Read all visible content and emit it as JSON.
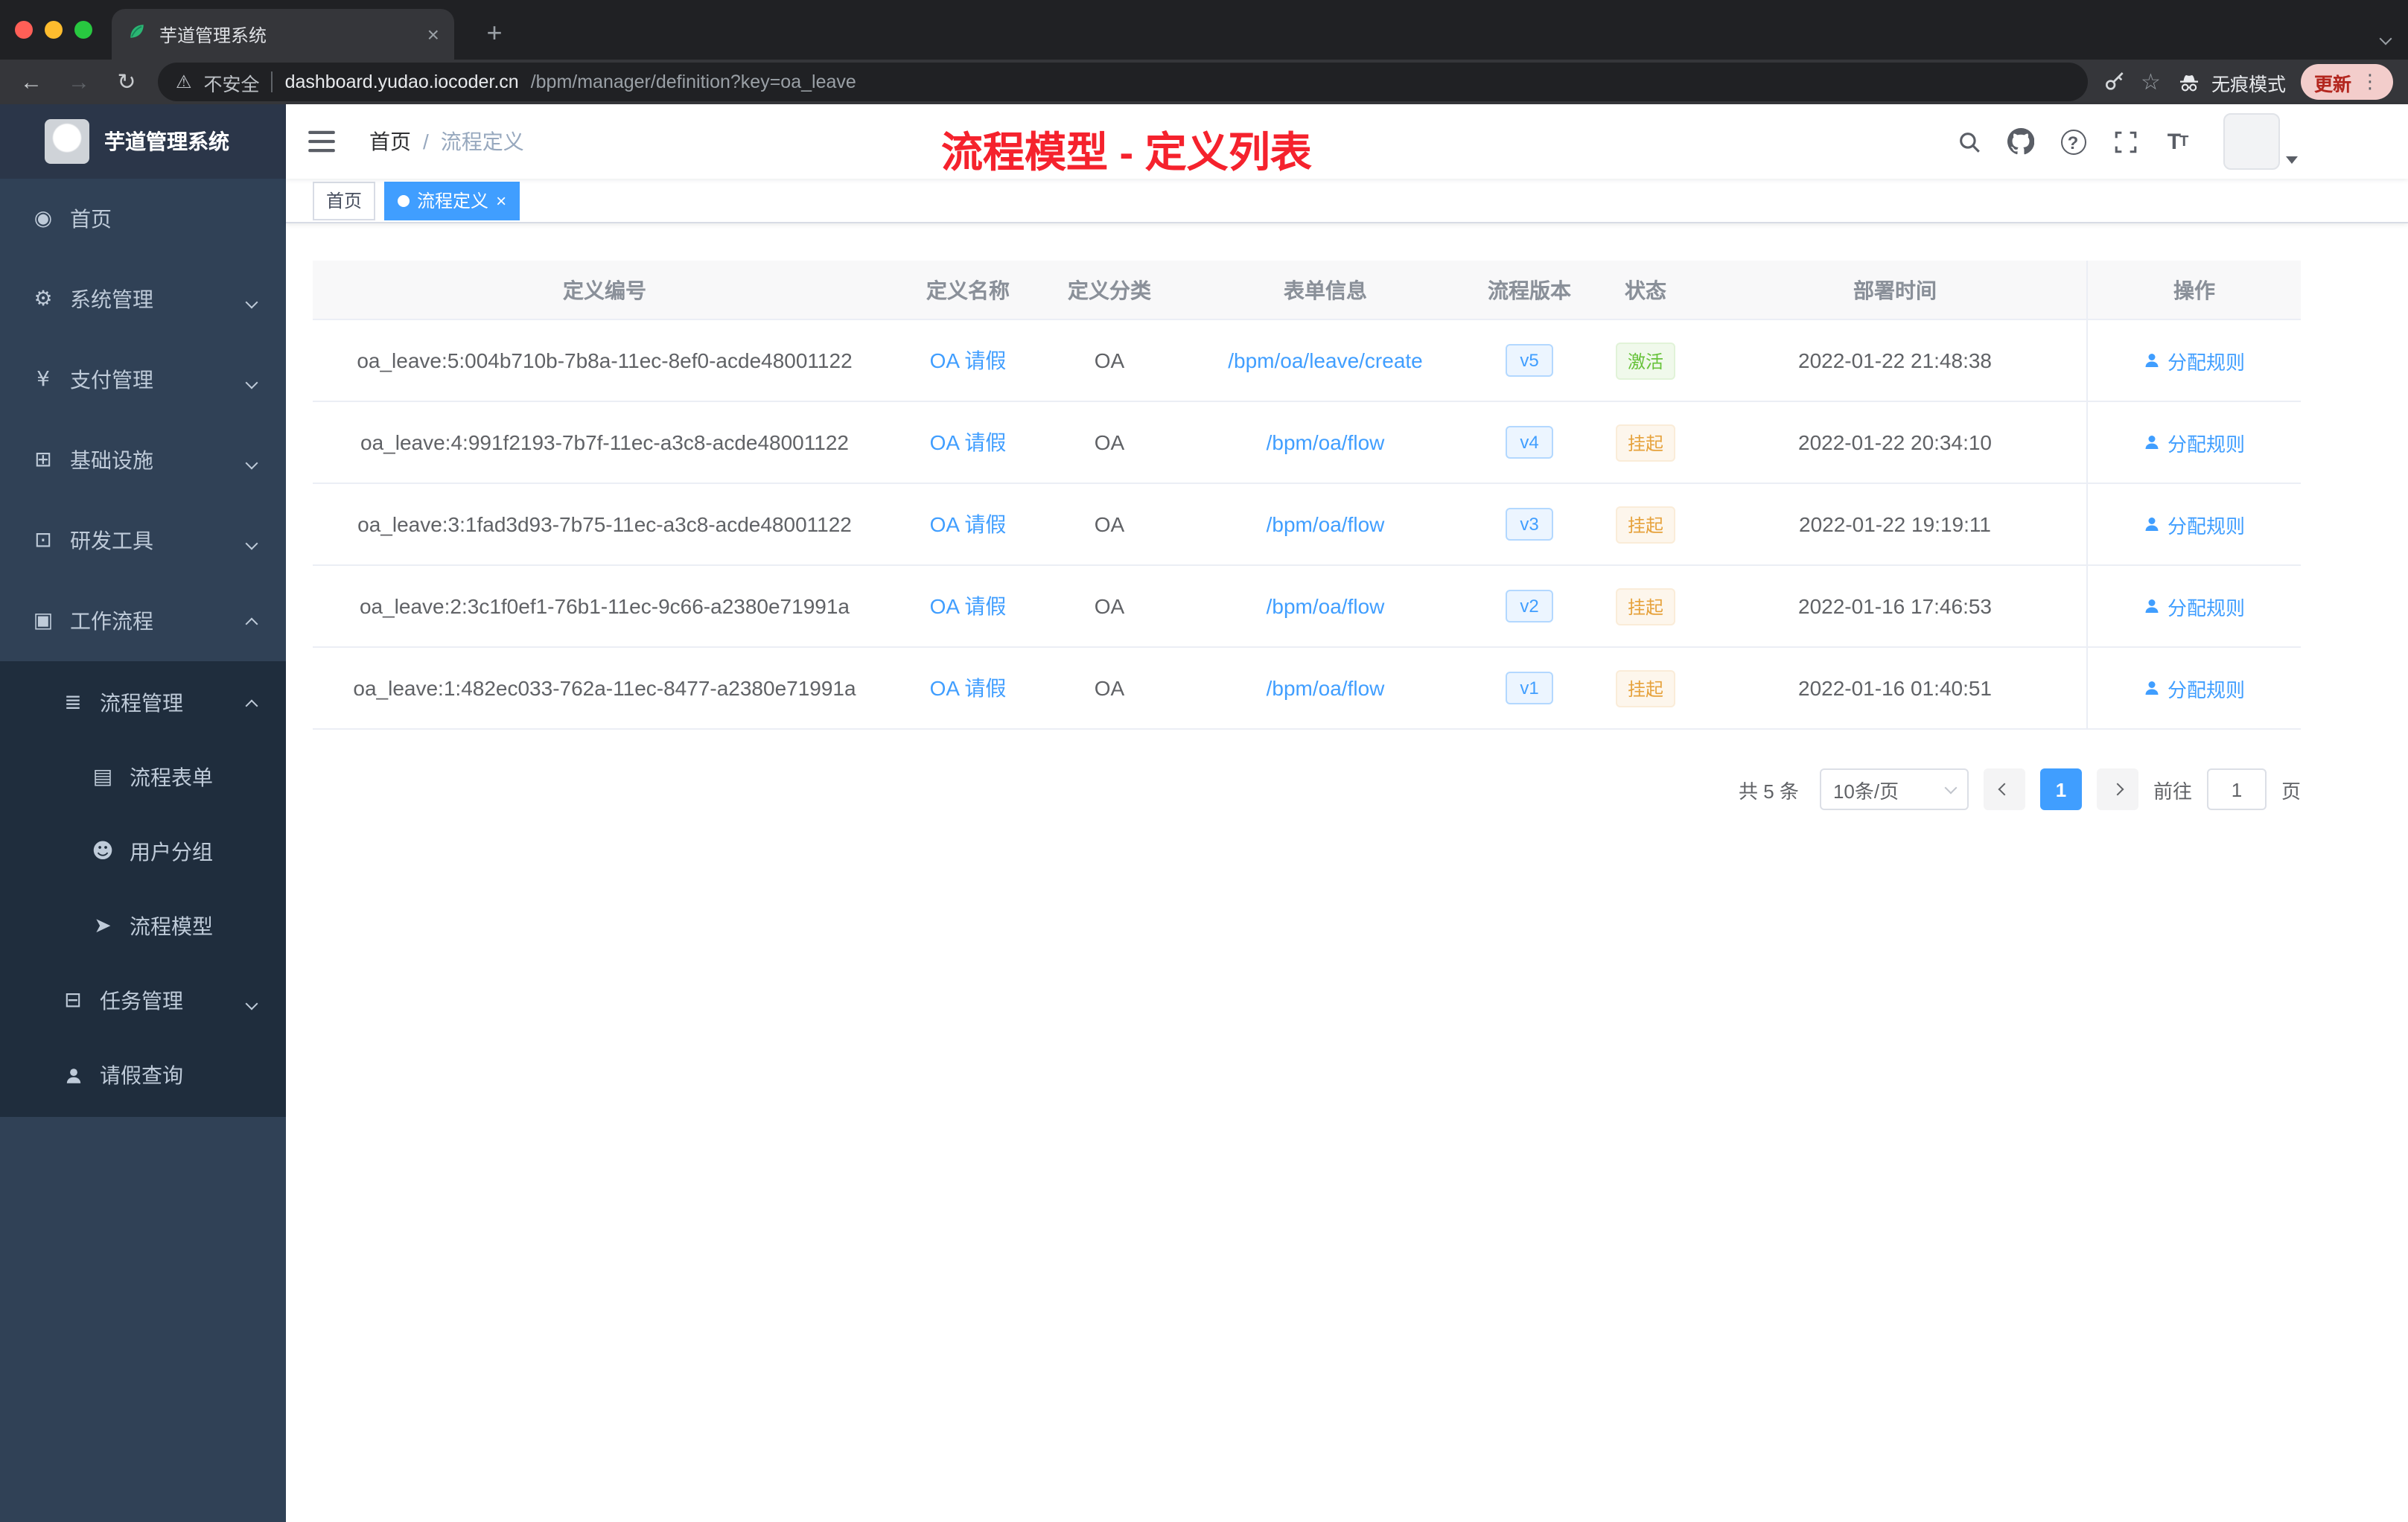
{
  "colors": {
    "accent": "#409eff",
    "success": "#67c23a",
    "warning": "#e6a23c",
    "annotation_red": "#f5222d",
    "sidebar_bg": "#304156",
    "sidebar_submenu_bg": "#1f2d3d"
  },
  "browser": {
    "tab_title": "芋道管理系统",
    "address": {
      "security_label": "不安全",
      "url_host": "dashboard.yudao.iocoder.cn",
      "url_path": "/bpm/manager/definition?key=oa_leave"
    },
    "incognito_label": "无痕模式",
    "update_label": "更新"
  },
  "sidebar": {
    "logo_title": "芋道管理系统",
    "items": [
      {
        "label": "首页",
        "icon": "dashboard-icon"
      },
      {
        "label": "系统管理",
        "icon": "gear-icon",
        "chevron": "down"
      },
      {
        "label": "支付管理",
        "icon": "yen-icon",
        "chevron": "down"
      },
      {
        "label": "基础设施",
        "icon": "infrastructure-icon",
        "chevron": "down"
      },
      {
        "label": "研发工具",
        "icon": "dev-tools-icon",
        "chevron": "down"
      },
      {
        "label": "工作流程",
        "icon": "workflow-icon",
        "chevron": "up"
      },
      {
        "label": "流程管理",
        "icon": "process-list-icon",
        "chevron": "up"
      },
      {
        "label": "流程表单",
        "icon": "form-icon"
      },
      {
        "label": "用户分组",
        "icon": "user-group-icon"
      },
      {
        "label": "流程模型",
        "icon": "send-icon"
      },
      {
        "label": "任务管理",
        "icon": "task-icon",
        "chevron": "down"
      },
      {
        "label": "请假查询",
        "icon": "person-icon"
      }
    ]
  },
  "header": {
    "breadcrumb": {
      "home": "首页",
      "separator": "/",
      "current": "流程定义"
    },
    "annotation_title": "流程模型 - 定义列表"
  },
  "tags": {
    "items": [
      {
        "label": "首页"
      },
      {
        "label": "流程定义"
      }
    ]
  },
  "table": {
    "headers": [
      "定义编号",
      "定义名称",
      "定义分类",
      "表单信息",
      "流程版本",
      "状态",
      "部署时间",
      "操作"
    ],
    "rows": [
      {
        "id": "oa_leave:5:004b710b-7b8a-11ec-8ef0-acde48001122",
        "name": "OA 请假",
        "category": "OA",
        "form": "/bpm/oa/leave/create",
        "version": "v5",
        "status": "激活",
        "status_type": "success",
        "deploy_time": "2022-01-22 21:48:38",
        "action": "分配规则"
      },
      {
        "id": "oa_leave:4:991f2193-7b7f-11ec-a3c8-acde48001122",
        "name": "OA 请假",
        "category": "OA",
        "form": "/bpm/oa/flow",
        "version": "v4",
        "status": "挂起",
        "status_type": "warning",
        "deploy_time": "2022-01-22 20:34:10",
        "action": "分配规则"
      },
      {
        "id": "oa_leave:3:1fad3d93-7b75-11ec-a3c8-acde48001122",
        "name": "OA 请假",
        "category": "OA",
        "form": "/bpm/oa/flow",
        "version": "v3",
        "status": "挂起",
        "status_type": "warning",
        "deploy_time": "2022-01-22 19:19:11",
        "action": "分配规则"
      },
      {
        "id": "oa_leave:2:3c1f0ef1-76b1-11ec-9c66-a2380e71991a",
        "name": "OA 请假",
        "category": "OA",
        "form": "/bpm/oa/flow",
        "version": "v2",
        "status": "挂起",
        "status_type": "warning",
        "deploy_time": "2022-01-16 17:46:53",
        "action": "分配规则"
      },
      {
        "id": "oa_leave:1:482ec033-762a-11ec-8477-a2380e71991a",
        "name": "OA 请假",
        "category": "OA",
        "form": "/bpm/oa/flow",
        "version": "v1",
        "status": "挂起",
        "status_type": "warning",
        "deploy_time": "2022-01-16 01:40:51",
        "action": "分配规则"
      }
    ]
  },
  "pagination": {
    "total_text": "共 5 条",
    "page_size_text": "10条/页",
    "current_page": "1",
    "goto_label": "前往",
    "goto_value": "1",
    "goto_unit": "页"
  }
}
